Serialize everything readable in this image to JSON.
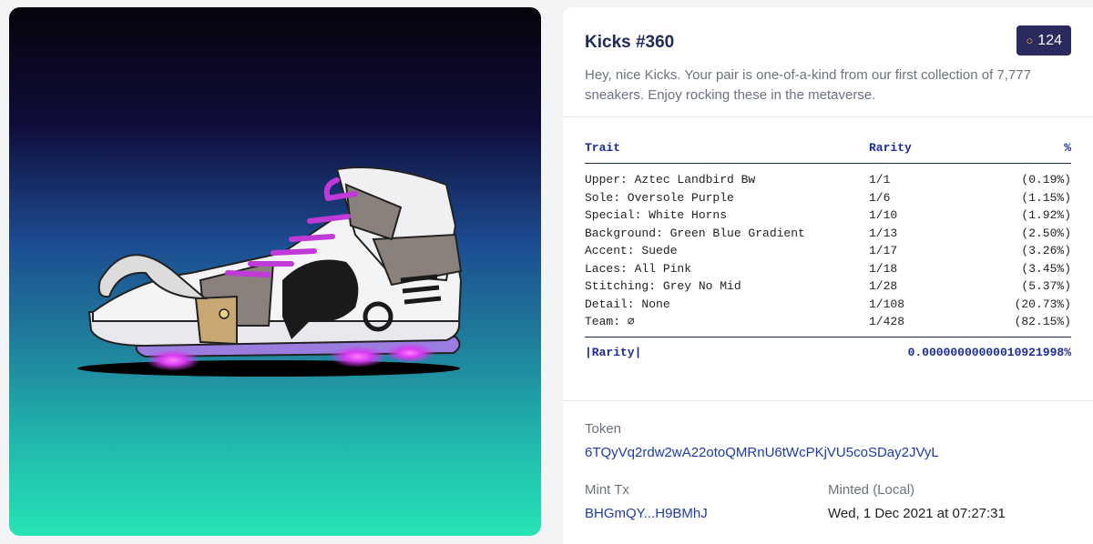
{
  "nft": {
    "title": "Kicks #360",
    "rank": "124",
    "rank_icon": "medal-icon",
    "description": "Hey, nice Kicks. Your pair is one-of-a-kind from our first collection of 7,777 sneakers. Enjoy rocking these in the metaverse."
  },
  "traits": {
    "headers": {
      "trait": "Trait",
      "rarity": "Rarity",
      "percent": "%"
    },
    "rows": [
      {
        "trait": "Upper: Aztec Landbird Bw",
        "rarity": "1/1",
        "percent": "(0.19%)"
      },
      {
        "trait": "Sole: Oversole Purple",
        "rarity": "1/6",
        "percent": "(1.15%)"
      },
      {
        "trait": "Special: White Horns",
        "rarity": "1/10",
        "percent": "(1.92%)"
      },
      {
        "trait": "Background: Green Blue Gradient",
        "rarity": "1/13",
        "percent": "(2.50%)"
      },
      {
        "trait": "Accent: Suede",
        "rarity": "1/17",
        "percent": "(3.26%)"
      },
      {
        "trait": "Laces: All Pink",
        "rarity": "1/18",
        "percent": "(3.45%)"
      },
      {
        "trait": "Stitching: Grey No Mid",
        "rarity": "1/28",
        "percent": "(5.37%)"
      },
      {
        "trait": "Detail: None",
        "rarity": "1/108",
        "percent": "(20.73%)"
      },
      {
        "trait": "Team: ∅",
        "rarity": "1/428",
        "percent": "(82.15%)"
      }
    ],
    "total_label": "|Rarity|",
    "total_value": "0.00000000000010921998%"
  },
  "token": {
    "label": "Token",
    "value": "6TQyVq2rdw2wA22otoQMRnU6tWcPKjVU5coSDay2JVyL"
  },
  "mint": {
    "tx_label": "Mint Tx",
    "tx_value": "BHGmQY...H9BMhJ",
    "date_label": "Minted (Local)",
    "date_value": "Wed, 1 Dec 2021 at 07:27:31"
  },
  "colors": {
    "badge_bg": "#2b2a5e",
    "link": "#1e3aa8",
    "heading": "#1e2a5a",
    "sole_glow": "#d63bf0",
    "laces": "#c03ad8"
  }
}
